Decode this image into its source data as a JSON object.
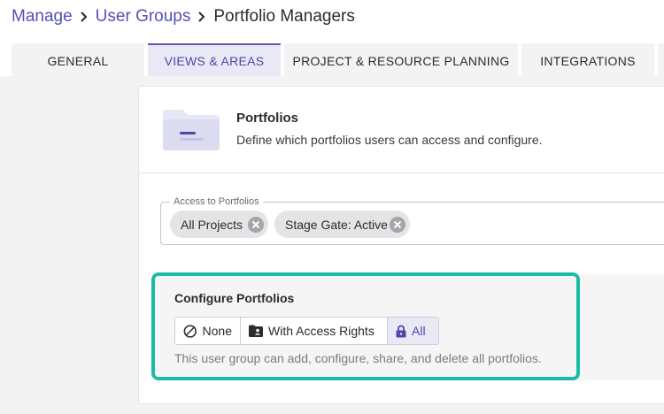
{
  "breadcrumb": {
    "items": [
      "Manage",
      "User Groups"
    ],
    "current": "Portfolio Managers"
  },
  "tabs": [
    {
      "label": "GENERAL",
      "active": false
    },
    {
      "label": "VIEWS & AREAS",
      "active": true
    },
    {
      "label": "PROJECT & RESOURCE PLANNING",
      "active": false
    },
    {
      "label": "INTEGRATIONS",
      "active": false
    }
  ],
  "portfolios": {
    "title": "Portfolios",
    "description": "Define which portfolios users can access and configure.",
    "icon": "folder-icon"
  },
  "access": {
    "label": "Access to Portfolios",
    "chips": [
      "All Projects",
      "Stage Gate: Active"
    ]
  },
  "configure": {
    "title": "Configure Portfolios",
    "options": [
      {
        "label": "None",
        "icon": "block-icon"
      },
      {
        "label": "With Access Rights",
        "icon": "folder-user-icon"
      },
      {
        "label": "All",
        "icon": "lock-icon"
      }
    ],
    "selected": "All",
    "description": "This user group can add, configure, share, and delete all portfolios."
  },
  "colors": {
    "accent": "#5451b4",
    "highlight": "#19bca5",
    "active_tab_bg": "#e9e9f6"
  }
}
